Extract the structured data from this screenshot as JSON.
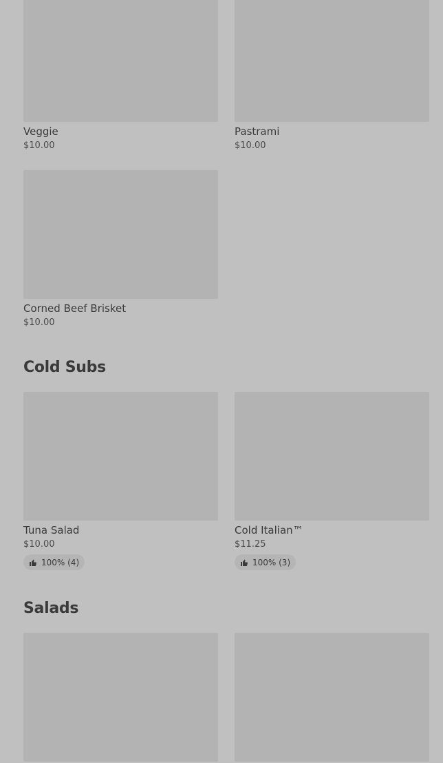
{
  "hot_items": [
    {
      "name": "Veggie",
      "price": "$10.00"
    },
    {
      "name": "Pastrami",
      "price": "$10.00"
    },
    {
      "name": "Corned Beef Brisket",
      "price": "$10.00"
    }
  ],
  "sections": {
    "cold_subs": {
      "title": "Cold Subs",
      "items": [
        {
          "name": "Tuna Salad",
          "price": "$10.00",
          "rating": "100% (4)"
        },
        {
          "name": "Cold Italian™",
          "price": "$11.25",
          "rating": "100% (3)"
        }
      ]
    },
    "salads": {
      "title": "Salads"
    }
  },
  "icons": {
    "rating": "thumbs-up-icon"
  }
}
